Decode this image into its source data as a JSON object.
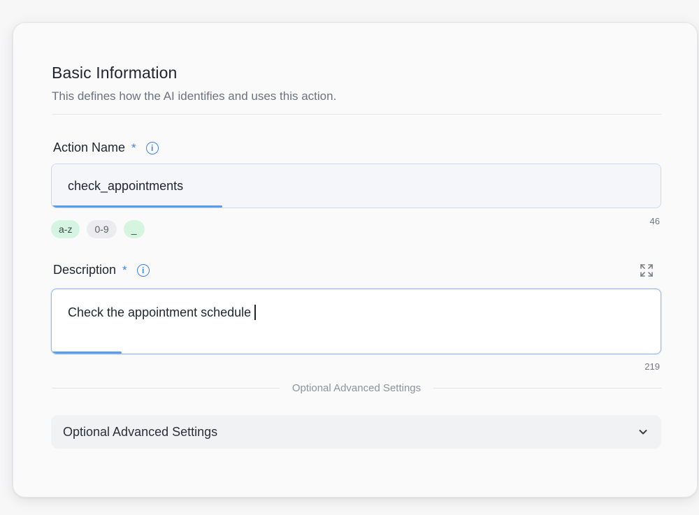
{
  "section": {
    "title": "Basic Information",
    "subtitle": "This defines how the AI identifies and uses this action."
  },
  "action_name": {
    "label": "Action Name",
    "required_marker": "*",
    "info_icon": "info-circle-icon",
    "value": "check_appointments",
    "fill_fraction": 0.28,
    "chips": [
      "a-z",
      "0-9",
      "_"
    ],
    "counter": "46"
  },
  "description": {
    "label": "Description",
    "required_marker": "*",
    "info_icon": "info-circle-icon",
    "expand_icon": "expand-icon",
    "value": "Check the appointment schedule",
    "fill_fraction": 0.115,
    "counter": "219"
  },
  "advanced": {
    "divider_text": "Optional Advanced Settings",
    "accordion_label": "Optional Advanced Settings",
    "chevron_icon": "chevron-down-icon"
  },
  "colors": {
    "accent": "#3b82f6",
    "chip_green": "#d6f5e0",
    "chip_gray": "#ececef"
  }
}
